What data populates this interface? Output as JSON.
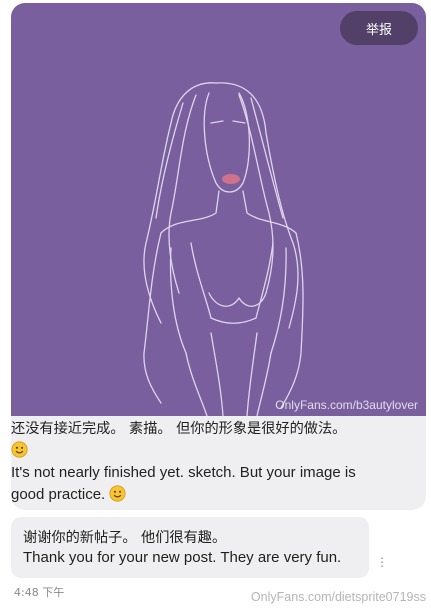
{
  "post": {
    "report_label": "举报",
    "image_watermark": "OnlyFans.com/b3autylover",
    "image_icon": "sketch-illustration",
    "colors": {
      "image_bg": "#7a5f9e",
      "bubble_bg": "#efeff1"
    }
  },
  "comment": {
    "zh": "还没有接近完成。 素描。 但你的形象是很好的做法。",
    "en_line1": "It's not nearly finished yet. sketch. But your image is",
    "en_line2": "good practice."
  },
  "reply": {
    "zh": "谢谢你的新帖子。 他们很有趣。",
    "en": "Thank you for your new post. They are very fun."
  },
  "footer": {
    "timestamp": "4:48 下午",
    "watermark": "OnlyFans.com/dietsprite0719ss"
  }
}
